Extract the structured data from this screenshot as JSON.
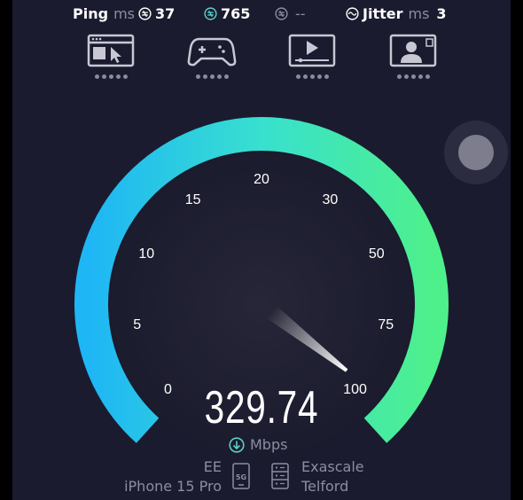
{
  "stats": {
    "ping": {
      "label": "Ping",
      "unit": "ms",
      "idle_value": "37",
      "download_value": "765",
      "upload_value": "--"
    },
    "jitter": {
      "label": "Jitter",
      "unit": "ms",
      "value": "3"
    }
  },
  "apps": [
    {
      "name": "web-browsing"
    },
    {
      "name": "gaming"
    },
    {
      "name": "video-streaming"
    },
    {
      "name": "video-chat"
    }
  ],
  "gauge": {
    "ticks": [
      "0",
      "5",
      "10",
      "15",
      "20",
      "30",
      "50",
      "75",
      "100"
    ],
    "needle_value_fraction": 1.0
  },
  "result": {
    "speed": "329.74",
    "unit": "Mbps"
  },
  "connection": {
    "carrier": "EE",
    "device": "iPhone 15 Pro",
    "network_badge": "5G",
    "server_name": "Exascale",
    "server_location": "Telford"
  },
  "colors": {
    "background": "#1b1b2f",
    "arc_start": "#1fb6f5",
    "arc_end": "#4ef08c",
    "accent_download": "#5ad2c8"
  }
}
